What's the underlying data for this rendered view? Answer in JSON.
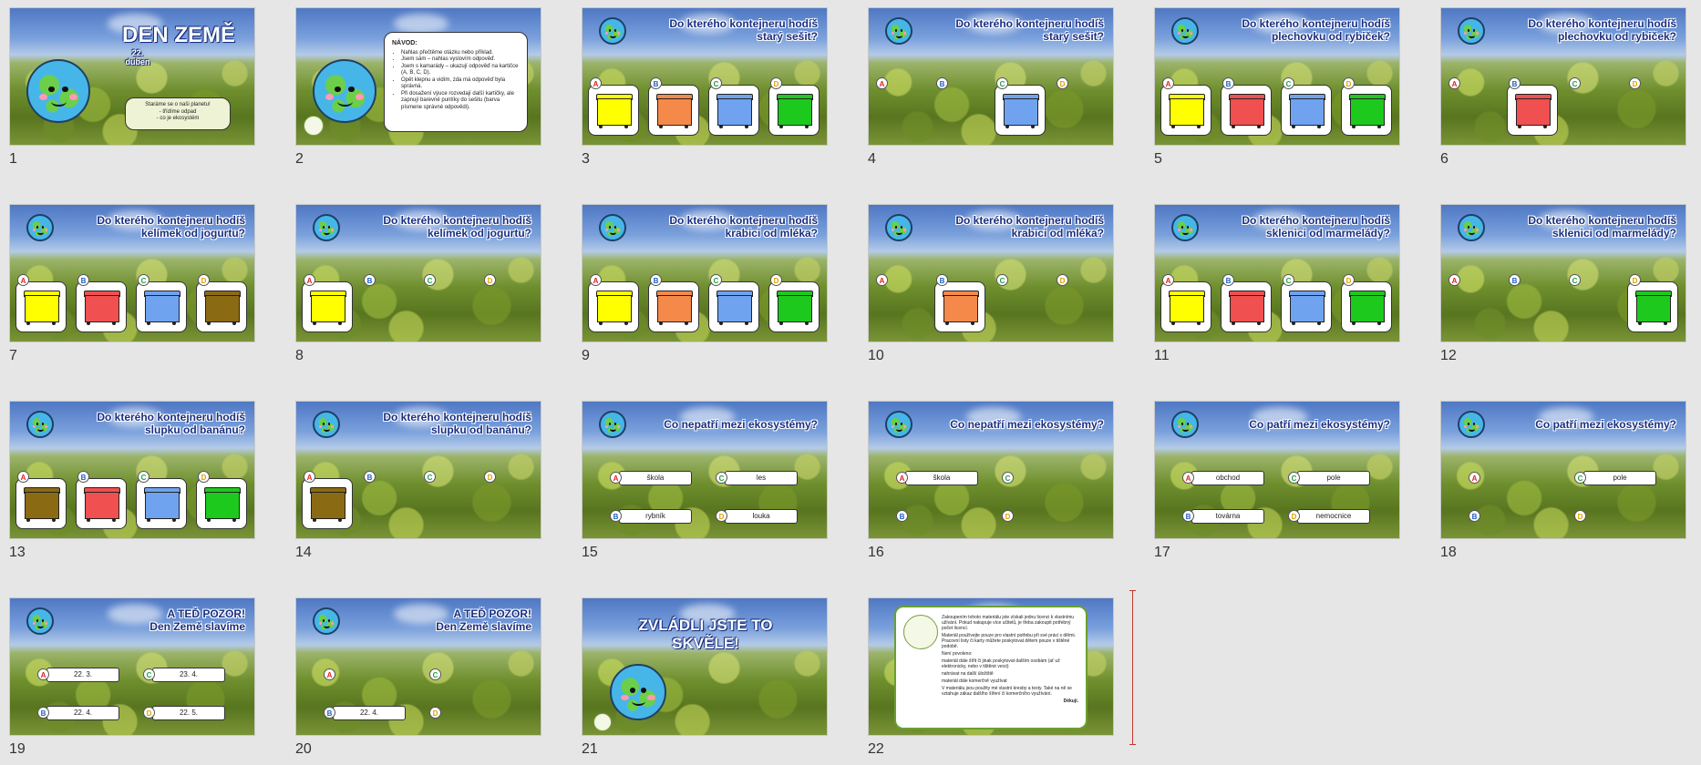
{
  "colors": {
    "yellow": "#ffff00",
    "orange": "#f5894a",
    "blue": "#6fa3f0",
    "green": "#1ec91e",
    "red": "#f05050",
    "brown": "#8b6a14"
  },
  "slides": [
    {
      "num": "1",
      "kind": "title",
      "title": "DEN ZEMĚ",
      "subtitle": "22. duben",
      "box": [
        "Staráme se o naši planetu!",
        "- třídíme odpad",
        "- co je ekosystém"
      ]
    },
    {
      "num": "2",
      "kind": "instructions",
      "heading": "NÁVOD:",
      "lines": [
        "Nahlas přečtěme otázku nebo příklad.",
        "Jsem sám – nahlas vyslovím odpověď.",
        "Jsem s kamarády – ukazují odpověď na kartičce (A, B, C, D).",
        "Opět klepnu a vidím, zda má odpověď byla správná.",
        "Při dosažení výuce rozvedají další kartičky, ale zapnují barevné puntíky do sešitu (barva písmene správné odpovědi)."
      ]
    },
    {
      "num": "3",
      "kind": "bins",
      "title": "Do kterého kontejneru hodíš\nstarý sešit?",
      "bins": [
        "yellow",
        "orange",
        "blue",
        "green"
      ],
      "show": [
        1,
        1,
        1,
        1
      ]
    },
    {
      "num": "4",
      "kind": "bins",
      "title": "Do kterého kontejneru hodíš\nstarý sešit?",
      "bins": [
        "yellow",
        "orange",
        "blue",
        "green"
      ],
      "show": [
        0,
        0,
        1,
        0
      ]
    },
    {
      "num": "5",
      "kind": "bins",
      "title": "Do kterého kontejneru hodíš\nplechovku od rybiček?",
      "bins": [
        "yellow",
        "red",
        "blue",
        "green"
      ],
      "show": [
        1,
        1,
        1,
        1
      ]
    },
    {
      "num": "6",
      "kind": "bins",
      "title": "Do kterého kontejneru hodíš\nplechovku od rybiček?",
      "bins": [
        "yellow",
        "red",
        "blue",
        "green"
      ],
      "show": [
        0,
        1,
        0,
        0
      ]
    },
    {
      "num": "7",
      "kind": "bins",
      "title": "Do kterého kontejneru hodíš\nkelímek od jogurtu?",
      "bins": [
        "yellow",
        "red",
        "blue",
        "brown"
      ],
      "show": [
        1,
        1,
        1,
        1
      ]
    },
    {
      "num": "8",
      "kind": "bins",
      "title": "Do kterého kontejneru hodíš\nkelímek od jogurtu?",
      "bins": [
        "yellow",
        "red",
        "blue",
        "brown"
      ],
      "show": [
        1,
        0,
        0,
        0
      ]
    },
    {
      "num": "9",
      "kind": "bins",
      "title": "Do kterého kontejneru hodíš\nkrabici od mléka?",
      "bins": [
        "yellow",
        "orange",
        "blue",
        "green"
      ],
      "show": [
        1,
        1,
        1,
        1
      ]
    },
    {
      "num": "10",
      "kind": "bins",
      "title": "Do kterého kontejneru hodíš\nkrabici od mléka?",
      "bins": [
        "yellow",
        "orange",
        "blue",
        "green"
      ],
      "show": [
        0,
        1,
        0,
        0
      ]
    },
    {
      "num": "11",
      "kind": "bins",
      "title": "Do kterého kontejneru hodíš\nsklenici od marmelády?",
      "bins": [
        "yellow",
        "red",
        "blue",
        "green"
      ],
      "show": [
        1,
        1,
        1,
        1
      ]
    },
    {
      "num": "12",
      "kind": "bins",
      "title": "Do kterého kontejneru hodíš\nsklenici od marmelády?",
      "bins": [
        "yellow",
        "red",
        "blue",
        "green"
      ],
      "show": [
        0,
        0,
        0,
        1
      ]
    },
    {
      "num": "13",
      "kind": "bins",
      "title": "Do kterého kontejneru hodíš\nslupku od banánu?",
      "bins": [
        "brown",
        "red",
        "blue",
        "green"
      ],
      "show": [
        1,
        1,
        1,
        1
      ]
    },
    {
      "num": "14",
      "kind": "bins",
      "title": "Do kterého kontejneru hodíš\nslupku od banánu?",
      "bins": [
        "brown",
        "red",
        "blue",
        "green"
      ],
      "show": [
        1,
        0,
        0,
        0
      ]
    },
    {
      "num": "15",
      "kind": "options",
      "title": "Co nepatří mezi ekosystémy?",
      "options": [
        "škola",
        "rybník",
        "les",
        "louka"
      ],
      "show": [
        1,
        1,
        1,
        1
      ]
    },
    {
      "num": "16",
      "kind": "options",
      "title": "Co nepatří mezi ekosystémy?",
      "options": [
        "škola",
        "rybník",
        "les",
        "louka"
      ],
      "show": [
        1,
        0,
        0,
        0
      ]
    },
    {
      "num": "17",
      "kind": "options",
      "title": "Co patří mezi ekosystémy?",
      "options": [
        "obchod",
        "továrna",
        "pole",
        "nemocnice"
      ],
      "show": [
        1,
        1,
        1,
        1
      ]
    },
    {
      "num": "18",
      "kind": "options",
      "title": "Co patří mezi ekosystémy?",
      "options": [
        "obchod",
        "továrna",
        "pole",
        "nemocnice"
      ],
      "show": [
        0,
        0,
        1,
        0
      ]
    },
    {
      "num": "19",
      "kind": "options",
      "title": "A TEĎ POZOR!\nDen Země slavíme",
      "options": [
        "22. 3.",
        "22. 4.",
        "23. 4.",
        "22. 5."
      ],
      "show": [
        1,
        1,
        1,
        1
      ]
    },
    {
      "num": "20",
      "kind": "options",
      "title": "A TEĎ POZOR!\nDen Země slavíme",
      "options": [
        "22. 3.",
        "22. 4.",
        "23. 4.",
        "22. 5."
      ],
      "show": [
        0,
        1,
        0,
        0
      ]
    },
    {
      "num": "21",
      "kind": "final",
      "title": "ZVLÁDLI JSTE TO\nSKVĚLE!"
    },
    {
      "num": "22",
      "kind": "credits",
      "lines": [
        "Zakoupením tohoto materiálu jste získali jednu licenci k vlastnímu užívání. Pokud nakupuje více učitelů, je třeba zakoupit potřebný počet licencí.",
        "Materiál používejte pouze pro vlastní potřebu při své práci s dětmi. Pracovní listy či karty můžete poskytovat dětem pouze v tištěné podobě.",
        "Není povoleno:",
        "materiál dále šířit či jinak poskytovat dalším osobám (ať už elektronicky, nebo v tištěné verzi)",
        "nahrávat na další úložiště",
        "materiál dále komerčně využívat",
        "V materiálu jsou použity mé vlastní kresby a texty. Také na ně se vztahuje zákaz dalšího šíření či komerčního využívání.",
        "Děkuji."
      ]
    }
  ]
}
